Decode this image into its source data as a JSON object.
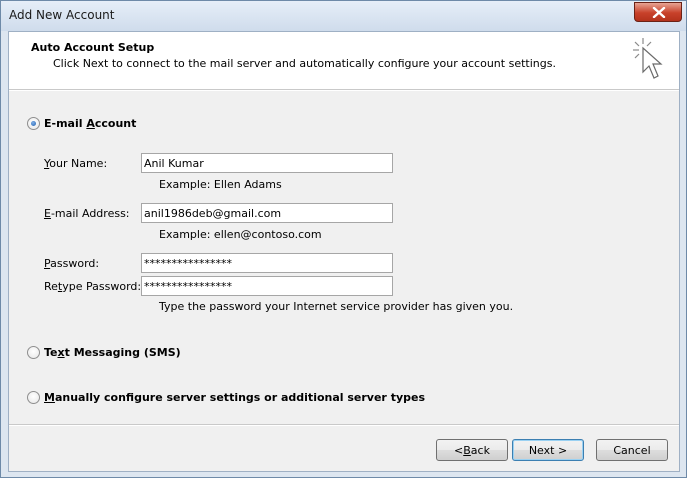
{
  "window": {
    "title": "Add New Account"
  },
  "header": {
    "title": "Auto Account Setup",
    "description": "Click Next to connect to the mail server and automatically configure your account settings."
  },
  "options": {
    "email": {
      "label_pre": "E-mail ",
      "label_key": "A",
      "label_post": "ccount",
      "selected": true
    },
    "sms": {
      "label_pre": "Te",
      "label_key": "x",
      "label_post": "t Messaging (SMS)",
      "selected": false
    },
    "manual": {
      "label_pre": "",
      "label_key": "M",
      "label_post": "anually configure server settings or additional server types",
      "selected": false
    }
  },
  "form": {
    "name": {
      "label_key": "Y",
      "label_post": "our Name:",
      "value": "Anil Kumar",
      "example": "Example: Ellen Adams"
    },
    "email": {
      "label_key": "E",
      "label_post": "-mail Address:",
      "value": "anil1986deb@gmail.com",
      "example": "Example: ellen@contoso.com"
    },
    "password": {
      "label_key": "P",
      "label_post": "assword:",
      "value": "****************"
    },
    "retype": {
      "label_pre": "Re",
      "label_key": "t",
      "label_post": "ype Password:",
      "value": "****************",
      "hint": "Type the password your Internet service provider has given you."
    }
  },
  "buttons": {
    "back": {
      "pre": "< ",
      "key": "B",
      "post": "ack"
    },
    "next": "Next >",
    "cancel": "Cancel"
  },
  "icons": {
    "close": "close-icon",
    "cursor": "cursor-sparkle-icon"
  }
}
